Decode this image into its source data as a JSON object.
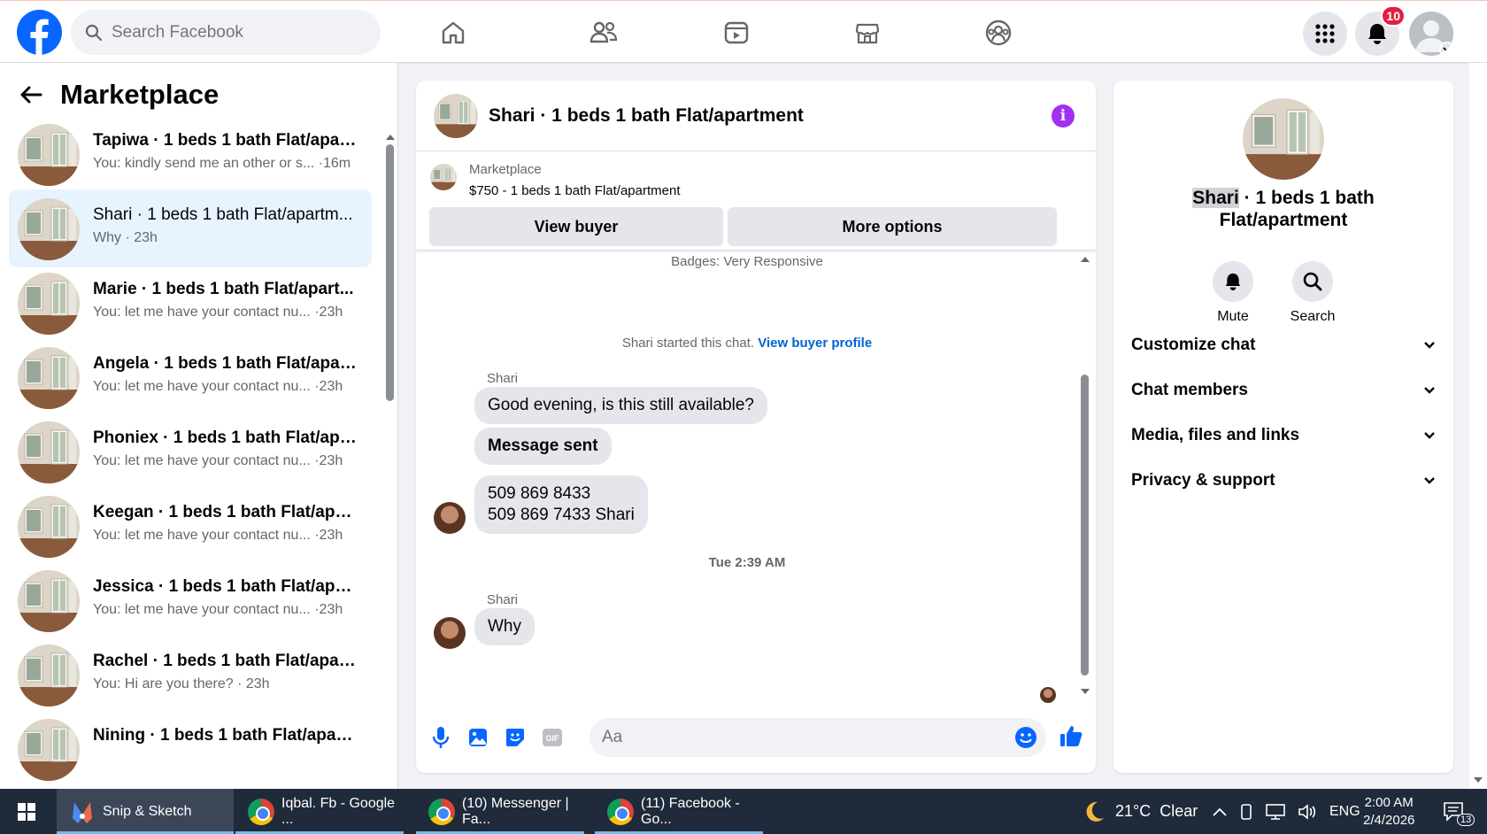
{
  "topbar": {
    "search_placeholder": "Search Facebook",
    "notifications_count": "10",
    "nav_icons": [
      "home-icon",
      "friends-icon",
      "watch-icon",
      "marketplace-icon",
      "groups-icon"
    ]
  },
  "sidebar": {
    "title": "Marketplace",
    "conversations": [
      {
        "name": "Tapiwa · 1 beds 1 bath Flat/apart...",
        "preview": "You: kindly send me an other or s... ·16m",
        "unread": true
      },
      {
        "name": "Shari · 1 beds 1 bath Flat/apartm...",
        "preview": "Why · 23h",
        "unread": false
      },
      {
        "name": "Marie · 1 beds 1 bath Flat/apart...",
        "preview": "You: let me have your contact nu... ·23h",
        "unread": true
      },
      {
        "name": "Angela · 1 beds 1 bath Flat/apart...",
        "preview": "You: let me have your contact nu... ·23h",
        "unread": true
      },
      {
        "name": "Phoniex · 1 beds 1 bath Flat/apar...",
        "preview": "You: let me have your contact nu... ·23h",
        "unread": true
      },
      {
        "name": "Keegan · 1 beds 1 bath Flat/apar...",
        "preview": "You: let me have your contact nu... ·23h",
        "unread": true
      },
      {
        "name": "Jessica · 1 beds 1 bath Flat/apart...",
        "preview": "You: let me have your contact nu... ·23h",
        "unread": true
      },
      {
        "name": "Rachel · 1 beds 1 bath Flat/apart...",
        "preview": "You: Hi are you there? · 23h",
        "unread": true
      },
      {
        "name": "Nining · 1 beds 1 bath Flat/apart...",
        "preview": "",
        "unread": true
      }
    ]
  },
  "chat": {
    "title": "Shari · 1 beds 1 bath Flat/apartment",
    "listing_tag": "Marketplace",
    "listing_price": "$750 - 1 beds 1 bath Flat/apartment",
    "view_buyer": "View buyer",
    "more_options": "More options",
    "badges": "Badges: Very Responsive",
    "started_text": "Shari started this chat.",
    "started_link": "View buyer profile",
    "sender": "Shari",
    "msg1": "Good evening, is this still available?",
    "msg2": "Message sent",
    "msg3_line1": "509 869 8433",
    "msg3_line2": "509 869 7433 Shari",
    "timestamp": "Tue 2:39 AM",
    "sender2": "Shari",
    "msg4": "Why",
    "composer_placeholder": "Aa"
  },
  "details": {
    "title_name": "Shari",
    "title_rest_1": "· 1 beds 1 bath",
    "title_rest_2": "Flat/apartment",
    "mute": "Mute",
    "search": "Search",
    "rows": [
      "Customize chat",
      "Chat members",
      "Media, files and links",
      "Privacy & support"
    ]
  },
  "taskbar": {
    "apps": [
      "Snip & Sketch",
      "Iqbal. Fb - Google ...",
      "(10) Messenger | Fa...",
      "(11) Facebook - Go..."
    ],
    "weather": "21°C  Clear",
    "lang": "ENG",
    "time": "2:00 AM",
    "date": "2/4/2026",
    "notif_count": "13"
  },
  "colors": {
    "accent": "#0866ff",
    "active_bg": "#e7f3ff",
    "info": "#a12ff5",
    "taskbar": "#1f2a3a"
  }
}
